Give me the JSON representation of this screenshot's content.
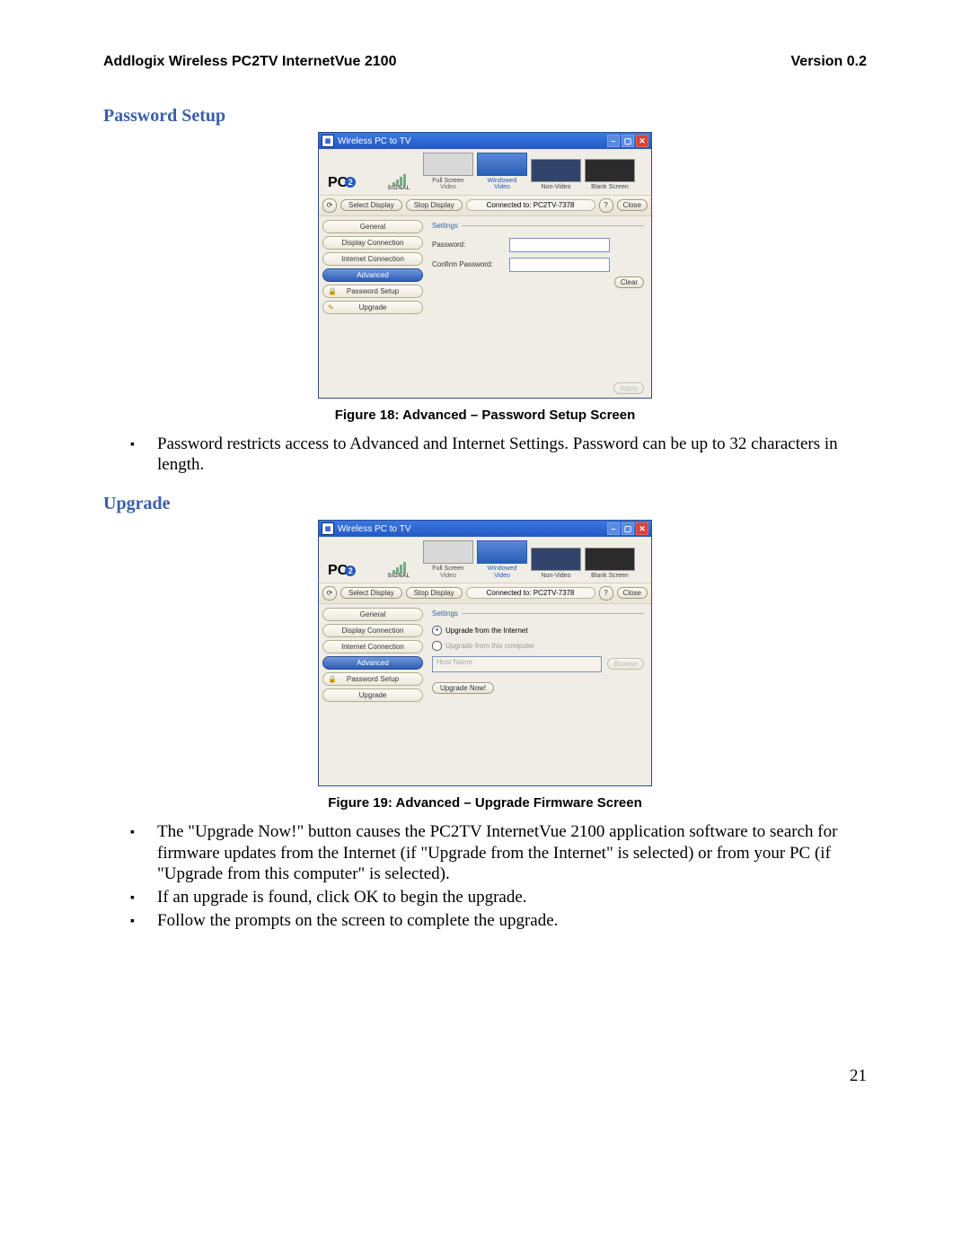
{
  "doc": {
    "header_left": "Addlogix Wireless PC2TV InternetVue 2100",
    "header_right": "Version 0.2",
    "page_number": "21"
  },
  "section1": {
    "title": "Password Setup",
    "caption": "Figure 18: Advanced – Password Setup Screen",
    "bullets": [
      "Password restricts access to Advanced and Internet Settings.  Password can be up to 32 characters in length."
    ]
  },
  "section2": {
    "title": "Upgrade",
    "caption": "Figure 19: Advanced – Upgrade Firmware Screen",
    "bullets": [
      "The \"Upgrade Now!\" button causes the PC2TV InternetVue 2100 application software to search for firmware updates from the Internet (if \"Upgrade from the Internet\" is selected) or from your PC (if \"Upgrade from this computer\" is selected).",
      "If an upgrade is found, click OK to begin the upgrade.",
      "Follow the prompts on the screen to complete the upgrade."
    ]
  },
  "app": {
    "title": "Wireless PC to TV",
    "logo": "PC",
    "logo_badge": "2",
    "signal": "SIGNAL",
    "modes": {
      "fullscreen": "Full Screen\nVideo",
      "windowed": "Windowed\nVideo",
      "nonvideo": "Non-Video",
      "blank": "Blank Screen"
    },
    "toolbar": {
      "select": "Select Display",
      "stop": "Stop Display",
      "status": "Connected to: PC2TV-7378",
      "help": "?",
      "close": "Close"
    },
    "nav": {
      "general": "General",
      "display": "Display Connection",
      "internet": "Internet Connection",
      "advanced": "Advanced",
      "password": "Password Setup",
      "upgrade": "Upgrade"
    },
    "password_panel": {
      "legend": "Settings",
      "pw": "Password:",
      "confirm": "Confirm Password:",
      "clear": "Clear",
      "apply": "Apply"
    },
    "upgrade_panel": {
      "legend": "Settings",
      "opt_internet": "Upgrade from the Internet",
      "opt_computer": "Upgrade from this computer",
      "hostname_ph": "Host Name",
      "browse": "Browse",
      "upgrade_now": "Upgrade Now!"
    }
  }
}
